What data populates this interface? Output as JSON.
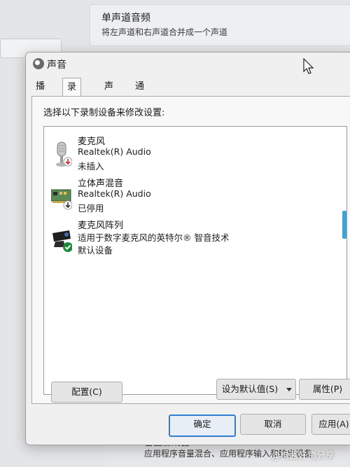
{
  "background": {
    "card_title": "单声道音频",
    "card_desc": "将左声道和右声道合并成一个声道",
    "bottom_title": "音量合成器",
    "bottom_desc": "应用程序音量混合、应用程序输入和输出设备"
  },
  "watermark": "@枸酱好物分享",
  "dialog": {
    "title": "声音",
    "tabs": [
      {
        "label": "播放"
      },
      {
        "label": "录制",
        "active": true
      },
      {
        "label": "声音"
      },
      {
        "label": "通信"
      }
    ],
    "instruction": "选择以下录制设备来修改设置:",
    "devices": [
      {
        "name": "麦克风",
        "driver": "Realtek(R) Audio",
        "status": "未插入",
        "icon": "microphone-icon",
        "badge": "unplugged-badge-icon"
      },
      {
        "name": "立体声混音",
        "driver": "Realtek(R) Audio",
        "status": "已停用",
        "icon": "sound-card-icon",
        "badge": "disabled-badge-icon"
      },
      {
        "name": "麦克风阵列",
        "driver": "适用于数字麦克风的英特尔® 智音技术",
        "status": "默认设备",
        "icon": "webcam-icon",
        "badge": "default-check-icon"
      }
    ],
    "buttons": {
      "configure": "配置(C)",
      "set_default": "设为默认值(S)",
      "properties": "属性(P)",
      "ok": "确定",
      "cancel": "取消",
      "apply": "应用(A)"
    }
  },
  "colors": {
    "accent": "#2f7fd0",
    "default_check": "#1e8a3a",
    "disabled_badge": "#c62828"
  }
}
